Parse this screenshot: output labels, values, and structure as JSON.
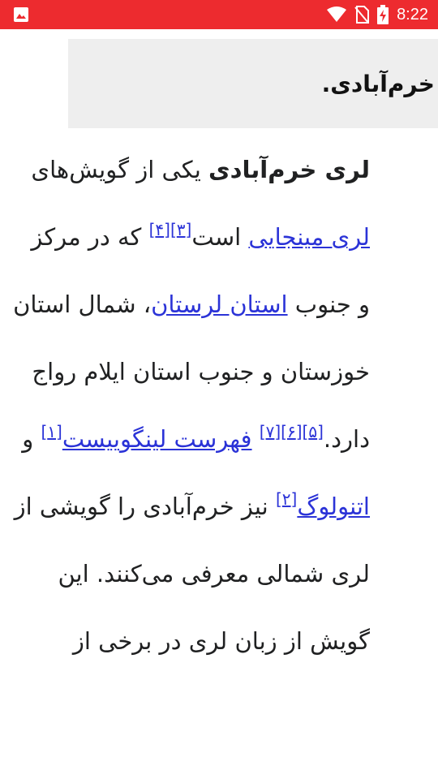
{
  "status_bar": {
    "time": "8:22",
    "icons": [
      "image-icon",
      "wifi-icon",
      "no-sim-icon",
      "battery-charging-icon"
    ],
    "background": "#ed2b2f"
  },
  "infobox": {
    "text": "خرم‌آبادی."
  },
  "article": {
    "lead_bold": "لری خرم‌آبادی",
    "t1": " یکی از گویش‌های ",
    "link_minjai": "لری مینجایی",
    "t2": " است",
    "ref3": "[۳]",
    "ref4": "[۴]",
    "t3": " که در مرکز و جنوب ",
    "link_lorestan": "استان لرستان",
    "t4": "، شمال استان خوزستان و جنوب استان ایلام رواج دارد.",
    "ref5": "[۵]",
    "ref6": "[۶]",
    "ref7": "[۷]",
    "t5": " ",
    "link_fehrest": "فهرست لینگوییست",
    "ref1": "[۱]",
    "t6": " و ",
    "link_ethnologue": "اتنولوگ",
    "ref2": "[۲]",
    "t7": " نیز خرم‌آبادی را گویشی از لری شمالی معرفی می‌کنند. این گویش از زبان لری در برخی از"
  },
  "colors": {
    "link": "#2b33d7",
    "text": "#202122",
    "infobox_bg": "#eeeeee"
  }
}
